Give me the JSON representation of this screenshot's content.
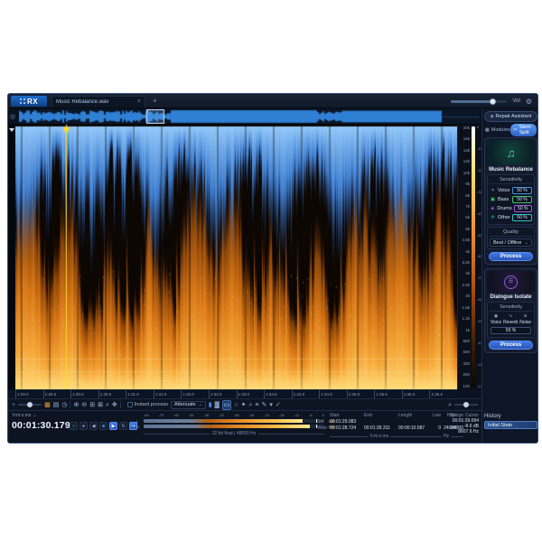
{
  "app": {
    "logo": "RX",
    "tab_title": "Music Rebalance.wav",
    "close": "×",
    "new_tab": "+",
    "vol": "Vol"
  },
  "right_panel": {
    "repair_assistant": "Repair Assistant",
    "tabs": [
      {
        "label": "Modules",
        "active": false
      },
      {
        "label": "Stem Split",
        "active": true
      }
    ],
    "music_rebalance": {
      "title": "Music Rebalance",
      "sensitivity": "Sensitivity",
      "rows": [
        {
          "label": "Voice",
          "value": "50 %",
          "color": "#4a90e2"
        },
        {
          "label": "Bass",
          "value": "50 %",
          "color": "#3ec46d"
        },
        {
          "label": "Drums",
          "value": "50 %",
          "color": "#a55ae0"
        },
        {
          "label": "Other",
          "value": "50 %",
          "color": "#2fc6c6"
        }
      ],
      "quality": "Quality",
      "quality_value": "Best / Offline",
      "process": "Process"
    },
    "dialogue_isolate": {
      "title": "Dialogue Isolate",
      "sensitivity": "Sensitivity",
      "columns": [
        "Voice",
        "Reverb",
        "Noise"
      ],
      "value": "50 %",
      "process": "Process"
    },
    "history": {
      "title": "History",
      "items": [
        "Initial State"
      ]
    }
  },
  "transport": {
    "format": "h:m:s.ms",
    "time": "00:01:30.179"
  },
  "meter": {
    "channels": [
      "L",
      "R"
    ],
    "scale": [
      "-inf",
      "-70",
      "-60",
      "-54",
      "-48",
      "-42",
      "-36",
      "-30",
      "-24",
      "-18",
      "-12",
      "-6",
      "0"
    ],
    "peaks": [
      "-6.0",
      "-6.0"
    ],
    "info": "32 bit float | 48000 Hz"
  },
  "selection": {
    "row_labels": [
      "Sel",
      "View"
    ],
    "cols": [
      "Start",
      "End",
      "Length"
    ],
    "sel_start": "00:01:29.083",
    "view": [
      "00:01:28.724",
      "00:01:39.311",
      "00:00:10.587"
    ],
    "unit_time": "h:m:s.ms",
    "freq_cols": [
      "Low",
      "High",
      "Range"
    ],
    "freq_values": [
      "0",
      "24000",
      "24000"
    ],
    "unit_freq": "Hz",
    "cursor_label": "Cursor",
    "cursor": [
      "00:01:29.094",
      "-8.6 dB",
      "8607.6 Hz"
    ]
  },
  "toolbar": {
    "instant_process": "Instant process",
    "mode": "Attenuate"
  },
  "timeline": {
    "ticks": [
      "1:29.0",
      "1:29.5",
      "1:30.0",
      "1:30.5",
      "1:31.0",
      "1:31.5",
      "1:32.0",
      "1:32.5",
      "1:33.0",
      "1:33.5",
      "1:34.0",
      "1:34.5",
      "1:35.0",
      "1:35.5",
      "1:36.0",
      "1:36.5"
    ]
  },
  "freq_axis": [
    "20k",
    "16k",
    "14k",
    "12k",
    "10k",
    "9k",
    "8k",
    "7k",
    "6k",
    "5k",
    "4.5k",
    "4k",
    "3.5k",
    "3k",
    "2.5k",
    "2k",
    "1.5k",
    "1.2k",
    "1k",
    "800",
    "600",
    "400",
    "250",
    "100"
  ],
  "db_axis": [
    "0",
    "-10",
    "-20",
    "-30",
    "-40",
    "-50",
    "-60",
    "-70",
    "-80",
    "-90",
    "-100",
    "-110",
    "-120"
  ],
  "icons": {
    "tools_a": [
      {
        "name": "spectrogram-color-icon",
        "g": "▩",
        "cls": "org"
      },
      {
        "name": "layout-table-icon",
        "g": "▤"
      },
      {
        "name": "history-clock-icon",
        "g": "◷"
      }
    ],
    "zoom_tools": [
      {
        "name": "zoom-in-icon",
        "g": "⊕"
      },
      {
        "name": "zoom-out-icon",
        "g": "⊖"
      },
      {
        "name": "zoom-fit-icon",
        "g": "⊞"
      },
      {
        "name": "zoom-selection-icon",
        "g": "⊠"
      },
      {
        "name": "magnifier-icon",
        "g": "⌕"
      },
      {
        "name": "hand-pan-icon",
        "g": "✥"
      }
    ],
    "display_toggles": [
      {
        "name": "waveform-display-icon",
        "g": "▮",
        "cls": "blu"
      },
      {
        "name": "spectrogram-display-icon",
        "g": "▓"
      }
    ],
    "select_tools": [
      {
        "name": "time-selection-icon",
        "g": "▭",
        "cls": "selon"
      },
      {
        "name": "lasso-selection-icon",
        "g": "○"
      },
      {
        "name": "magic-wand-icon",
        "g": "✦"
      },
      {
        "name": "zoom-tool-icon",
        "g": "⌕"
      },
      {
        "name": "adjust-tool-icon",
        "g": "≡"
      },
      {
        "name": "brush-tool-icon",
        "g": "✎"
      },
      {
        "name": "chevron-down-icon",
        "g": "▾"
      },
      {
        "name": "confirm-check-icon",
        "g": "✓"
      }
    ],
    "transport": [
      {
        "name": "loop-playback-button",
        "g": "○"
      },
      {
        "name": "record-button",
        "g": "●"
      },
      {
        "name": "rewind-button",
        "g": "◀"
      },
      {
        "name": "stop-button",
        "g": "■",
        "cls": "gblue"
      },
      {
        "name": "play-button",
        "g": "▶",
        "cls": "act"
      },
      {
        "name": "repeat-button",
        "g": "↻"
      },
      {
        "name": "output-routing-button",
        "g": "↪",
        "cls": "actb"
      }
    ]
  },
  "colors": {
    "accent": "#3f74d8",
    "spectrogram_orange": "#f0a030",
    "waveform_blue": "#2f7fd4",
    "playhead_yellow": "#ffd82e"
  }
}
